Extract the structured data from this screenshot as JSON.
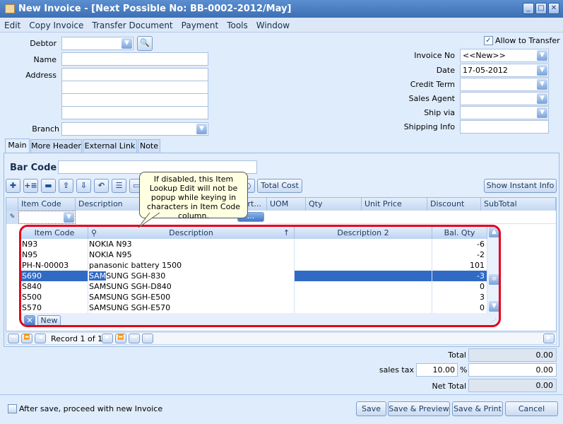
{
  "window": {
    "title": "New Invoice - [Next Possible No: BB-0002-2012/May]"
  },
  "menu": [
    "Edit",
    "Copy Invoice",
    "Transfer Document",
    "Payment",
    "Tools",
    "Window"
  ],
  "header": {
    "debtor_label": "Debtor",
    "name_label": "Name",
    "address_label": "Address",
    "branch_label": "Branch",
    "allow_transfer": "Allow to Transfer",
    "allow_transfer_checked": true,
    "invoice_no_label": "Invoice No",
    "invoice_no": "<<New>>",
    "date_label": "Date",
    "date": "17-05-2012",
    "credit_term_label": "Credit Term",
    "sales_agent_label": "Sales Agent",
    "ship_via_label": "Ship via",
    "shipping_info_label": "Shipping Info"
  },
  "tabs": [
    "Main",
    "More Header",
    "External Link",
    "Note"
  ],
  "barcode_label": "Bar Code",
  "toolbar": {
    "total_cost": "Total Cost",
    "show_instant_info": "Show Instant Info"
  },
  "tooltip": "If disabled, this Item Lookup Edit will not be popup while keying in characters in Item Code column.",
  "grid": {
    "columns": [
      "Item Code",
      "Description",
      "...rt...",
      "UOM",
      "Qty",
      "Unit Price",
      "Discount",
      "SubTotal"
    ],
    "edit_button": "..."
  },
  "lookup": {
    "columns": [
      "Item Code",
      "Description",
      "Description 2",
      "Bal. Qty"
    ],
    "rows": [
      {
        "code": "N93",
        "desc": "NOKIA N93",
        "desc2": "",
        "qty": "-6"
      },
      {
        "code": "N95",
        "desc": "NOKIA N95",
        "desc2": "",
        "qty": "-2"
      },
      {
        "code": "PH-N-00003",
        "desc": "panasonic battery 1500",
        "desc2": "",
        "qty": "101"
      },
      {
        "code": "S690",
        "desc": "SAMSUNG SGH-830",
        "desc2": "",
        "qty": "-3"
      },
      {
        "code": "S840",
        "desc": "SAMSUNG SGH-D840",
        "desc2": "",
        "qty": "0"
      },
      {
        "code": "S500",
        "desc": "SAMSUNG SGH-E500",
        "desc2": "",
        "qty": "3"
      },
      {
        "code": "S570",
        "desc": "SAMSUNG SGH-E570",
        "desc2": "",
        "qty": "0"
      }
    ],
    "selected_index": 3,
    "new_button": "New"
  },
  "navigator": {
    "record": "Record 1 of 1"
  },
  "totals": {
    "total_label": "Total",
    "total": "0.00",
    "tax_label": "sales tax",
    "tax_rate": "10.00",
    "percent": "%",
    "tax": "0.00",
    "net_label": "Net Total",
    "net": "0.00"
  },
  "footer": {
    "proceed_label": "After save, proceed with new Invoice",
    "save": "Save",
    "save_preview": "Save & Preview",
    "save_print": "Save & Print",
    "cancel": "Cancel"
  }
}
